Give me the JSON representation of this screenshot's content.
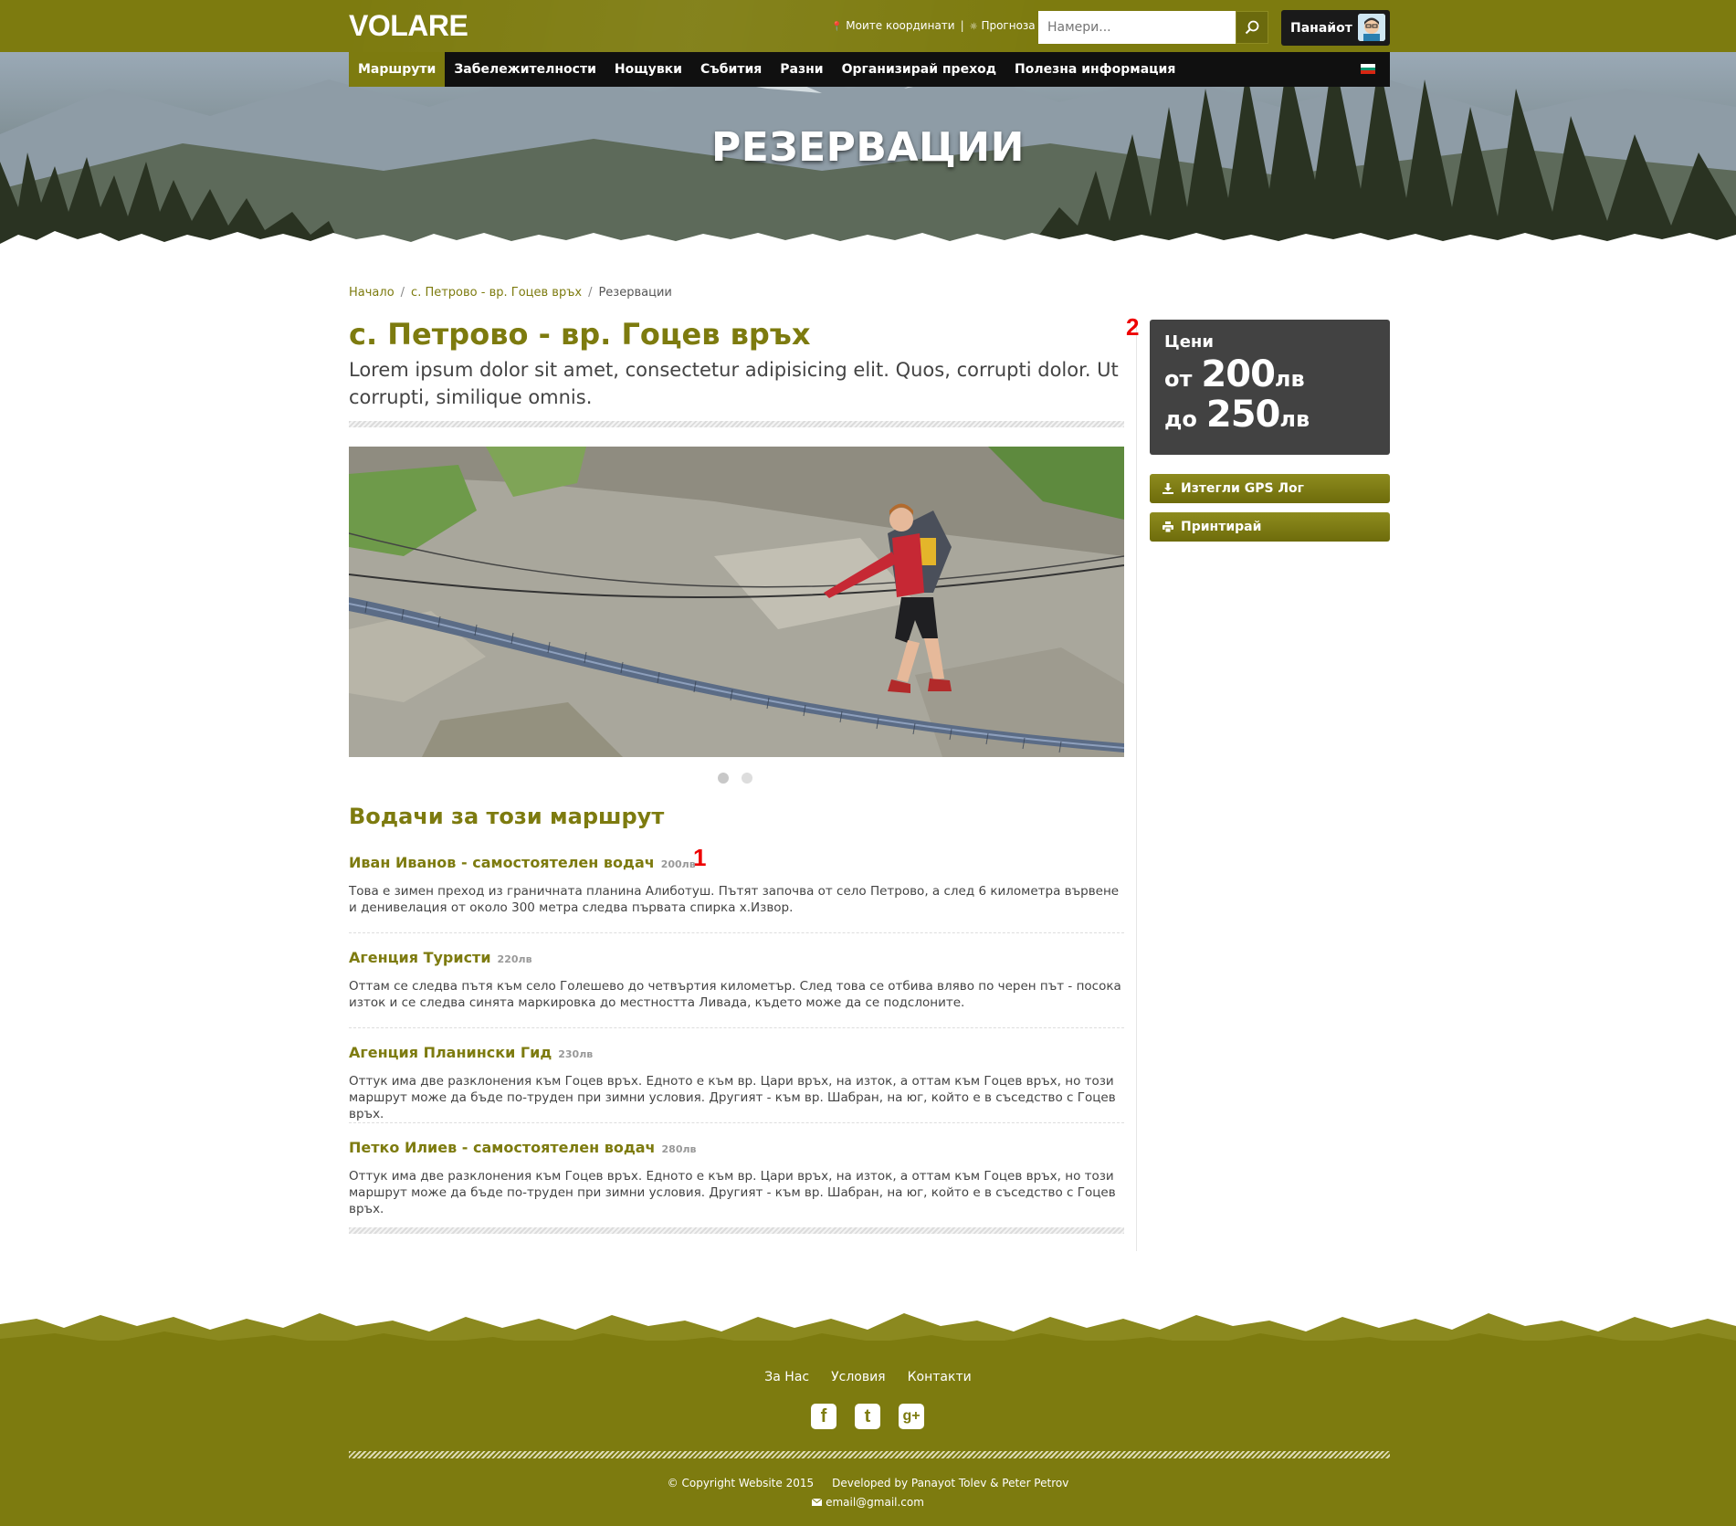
{
  "header": {
    "logo": "VOLARE",
    "links": [
      {
        "label": "Моите координати",
        "icon": "map-pin-icon"
      },
      {
        "label": "Прогноза",
        "icon": "sun-icon"
      }
    ],
    "separator": "|",
    "search": {
      "placeholder": "Намери...",
      "icon": "search-icon"
    },
    "user": {
      "name": "Панайот",
      "avatar_icon": "avatar-icon"
    }
  },
  "nav": {
    "items": [
      {
        "label": "Маршрути",
        "active": true
      },
      {
        "label": "Забележителности",
        "active": false
      },
      {
        "label": "Нощувки",
        "active": false
      },
      {
        "label": "Събития",
        "active": false
      },
      {
        "label": "Разни",
        "active": false
      },
      {
        "label": "Организирай преход",
        "active": false
      },
      {
        "label": "Полезна информация",
        "active": false
      }
    ],
    "language_icon": "flag-bg-icon"
  },
  "hero": {
    "title": "РЕЗЕРВАЦИИ"
  },
  "breadcrumb": {
    "items": [
      "Начало",
      "с. Петрово - вр. Гоцев връх",
      "Резервации"
    ],
    "separator": "/"
  },
  "route": {
    "title": "с. Петрово - вр. Гоцев връх",
    "lead": "Lorem ipsum dolor sit amet, consectetur adipisicing elit. Quos, corrupti dolor. Ut corrupti, similique omnis.",
    "carousel": {
      "slides": 2,
      "active": 0
    }
  },
  "guides": {
    "title": "Водачи за този маршрут",
    "items": [
      {
        "name": "Иван Иванов - самостоятелен водач",
        "price": "200лв",
        "description": "Това е зимен преход из граничната планина Алиботуш. Пътят започва от село Петрово, а след 6 километра вървене и денивелация от около 300 метра следва първата спирка х.Извор."
      },
      {
        "name": "Агенция Туристи",
        "price": "220лв",
        "description": "Оттам се следва пътя към село Голешево до четвъртия километър. След това се отбива вляво по черен път - посока изток и се следва синята маркировка до местността Ливада, където може да се подслоните."
      },
      {
        "name": "Агенция Планински Гид",
        "price": "230лв",
        "description": "Оттук има две разклонения към Гоцев връх. Едното е към вр. Цари връх, на изток, а оттам към Гоцев връх, но този маршрут може да бъде по-труден при зимни условия. Другият - към вр. Шабран, на юг, който е в съседство с Гоцев връх."
      },
      {
        "name": "Петко Илиев - самостоятелен водач",
        "price": "280лв",
        "description": "Оттук има две разклонения към Гоцев връх. Едното е към вр. Цари връх, на изток, а оттам към Гоцев връх, но този маршрут може да бъде по-труден при зимни условия. Другият - към вр. Шабран, на юг, който е в съседство с Гоцев връх."
      }
    ]
  },
  "annotations": {
    "one": "1",
    "two": "2"
  },
  "sidebar": {
    "prices": {
      "label": "Цени",
      "from_prefix": "от",
      "from_value": "200",
      "from_unit": "лв",
      "to_prefix": "до",
      "to_value": "250",
      "to_unit": "лв"
    },
    "buttons": [
      {
        "label": "Изтегли GPS Лог",
        "icon": "download-icon"
      },
      {
        "label": "Принтирай",
        "icon": "print-icon"
      }
    ]
  },
  "footer": {
    "links": [
      "За Нас",
      "Условия",
      "Контакти"
    ],
    "social": [
      {
        "icon": "facebook-icon",
        "glyph": "f"
      },
      {
        "icon": "twitter-icon",
        "glyph": "t"
      },
      {
        "icon": "google-plus-icon",
        "glyph": "g+"
      }
    ],
    "copyright": "© Copyright Website 2015",
    "developed_by": "Developed by Panayot Tolev & Peter Petrov",
    "email": "email@gmail.com"
  },
  "colors": {
    "brand": "#7d7b0f",
    "nav_bg": "#101010",
    "price_box": "#424242",
    "annotation": "#ee0000"
  }
}
